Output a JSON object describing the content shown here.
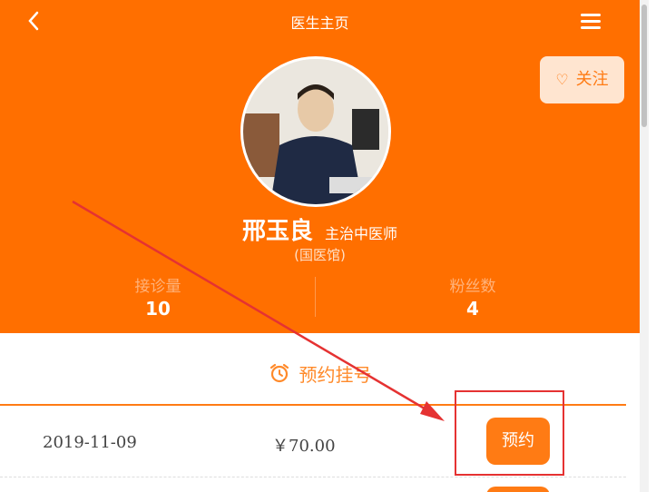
{
  "header": {
    "back_icon": "chevron-left-icon",
    "title": "医生主页",
    "menu_icon": "hamburger-menu-icon"
  },
  "doctor": {
    "name": "邢玉良",
    "rank": "主治中医师",
    "hospital": "(国医馆)",
    "follow_label": "关注",
    "follow_icon": "heart-outline-icon"
  },
  "stats": [
    {
      "label": "接诊量",
      "value": "10"
    },
    {
      "label": "粉丝数",
      "value": "4"
    }
  ],
  "booking": {
    "section_title": "预约挂号",
    "section_icon": "alarm-clock-icon",
    "slots": [
      {
        "date": "2019-11-09",
        "price": "￥70.00",
        "button_label": "预约"
      }
    ]
  },
  "colors": {
    "brand": "#ff6f00",
    "accent": "#ff7b14",
    "annotation": "#e53232"
  }
}
